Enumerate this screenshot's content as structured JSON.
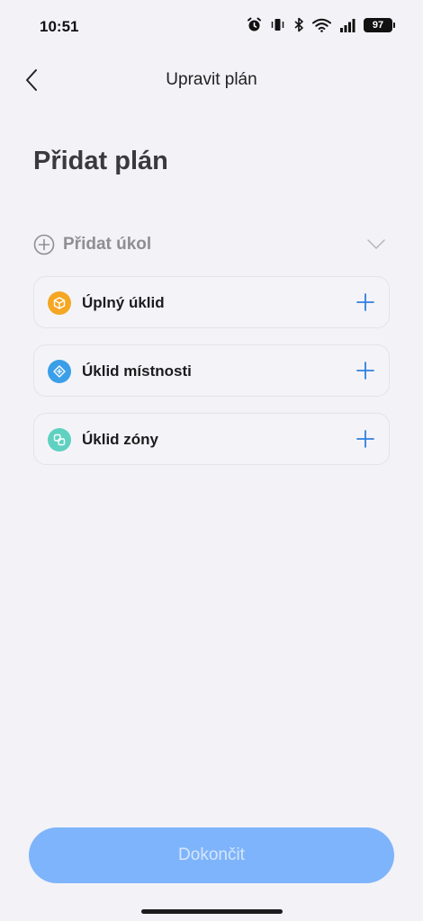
{
  "status_bar": {
    "time": "10:51",
    "battery": "97",
    "icons": [
      "alarm-icon",
      "vibrate-icon",
      "bluetooth-icon",
      "wifi-icon",
      "signal-icon",
      "battery-icon"
    ]
  },
  "header": {
    "title": "Upravit plán",
    "back_icon": "chevron-left-icon"
  },
  "page": {
    "title": "Přidat plán"
  },
  "add_task": {
    "label": "Přidat úkol",
    "icon": "plus-circle-icon",
    "expand_icon": "chevron-down-icon"
  },
  "tasks": [
    {
      "label": "Úplný úklid",
      "icon": "cube-icon",
      "color": "#f5a623"
    },
    {
      "label": "Úklid místnosti",
      "icon": "room-icon",
      "color": "#3a9fe8"
    },
    {
      "label": "Úklid zóny",
      "icon": "zone-icon",
      "color": "#5fd1c0"
    }
  ],
  "footer": {
    "done_label": "Dokončit"
  },
  "colors": {
    "background": "#f2f2f7",
    "accent": "#2f7fe0",
    "button_disabled": "#7eb4fb"
  }
}
